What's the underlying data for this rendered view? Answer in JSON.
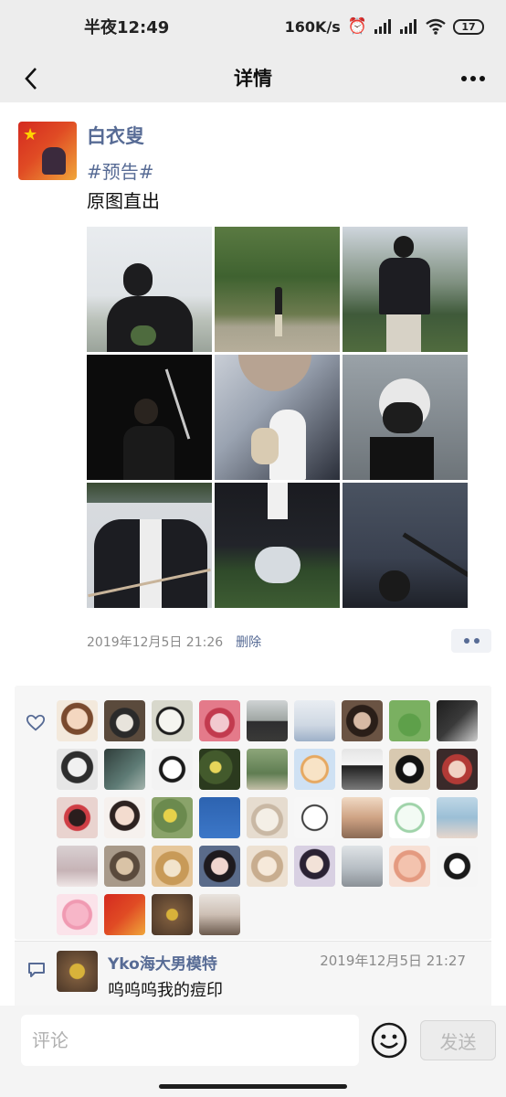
{
  "status_bar": {
    "time": "半夜12:49",
    "network_speed": "160K/s",
    "battery": "17"
  },
  "header": {
    "title": "详情"
  },
  "post": {
    "username": "白衣叟",
    "tag": "#预告#",
    "text": "原图直出",
    "timestamp": "2019年12月5日 21:26",
    "delete_label": "删除",
    "photo_count": 9
  },
  "likes": {
    "count": 41
  },
  "comment": {
    "username": "Yko海大男模特",
    "time": "2019年12月5日 21:27",
    "text": "呜呜呜我的痘印"
  },
  "input": {
    "placeholder": "评论",
    "send_label": "发送"
  },
  "colors": {
    "link": "#576b95",
    "nav_bg": "#ededed",
    "likes_bg": "#f6f6f6"
  }
}
